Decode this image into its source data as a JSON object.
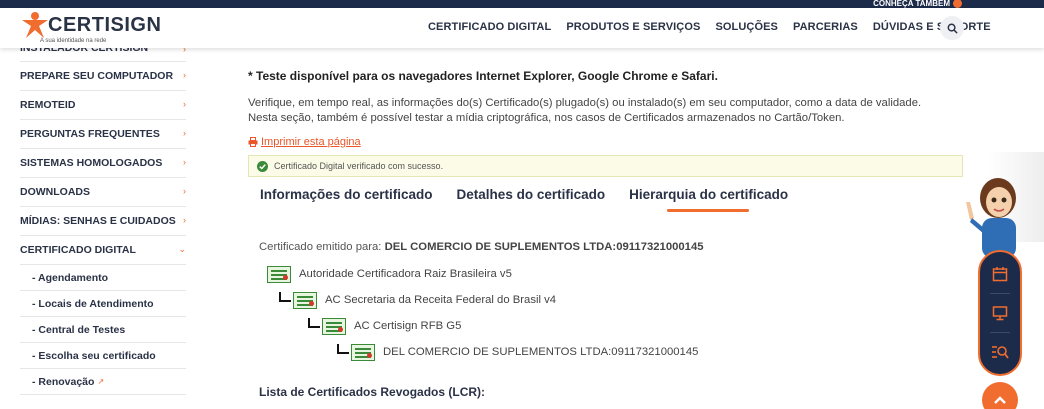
{
  "topbar": {
    "conheca_label": "CONHEÇA TAMBÉM"
  },
  "header": {
    "brand": "CERTISIGN",
    "tagline": "A sua identidade na rede",
    "nav": [
      "CERTIFICADO DIGITAL",
      "PRODUTOS E SERVIÇOS",
      "SOLUÇÕES",
      "PARCERIAS",
      "DÚVIDAS E SUPORTE"
    ]
  },
  "sidebar": {
    "items": [
      "INSTALADOR CERTISIGN",
      "PREPARE SEU COMPUTADOR",
      "REMOTEID",
      "PERGUNTAS FREQUENTES",
      "SISTEMAS HOMOLOGADOS",
      "DOWNLOADS",
      "MÍDIAS: SENHAS E CUIDADOS",
      "CERTIFICADO DIGITAL"
    ],
    "subitems": [
      "- Agendamento",
      "- Locais de Atendimento",
      "- Central de Testes",
      "- Escolha seu certificado",
      "- Renovação"
    ]
  },
  "main": {
    "note": "* Teste disponível para os navegadores Internet Explorer, Google Chrome e Safari.",
    "desc_line1": "Verifique, em tempo real, as informações do(s) Certificado(s) plugado(s) ou instalado(s) em seu computador, como a data de validade.",
    "desc_line2": "Nesta seção, também é possível testar a mídia criptográfica, nos casos de Certificados armazenados no Cartão/Token.",
    "print_label": "Imprimir esta página",
    "alert": "Certificado Digital verificado com sucesso.",
    "tabs": [
      "Informações do certificado",
      "Detalhes do certificado",
      "Hierarquia do certificado"
    ],
    "active_tab": "Hierarquia do certificado",
    "emitido_label": "Certificado emitido para:",
    "emitido_value": "DEL COMERCIO DE SUPLEMENTOS LTDA:09117321000145",
    "hierarchy": [
      "Autoridade Certificadora Raiz Brasileira v5",
      "AC Secretaria da Receita Federal do Brasil v4",
      "AC Certisign RFB G5",
      "DEL COMERCIO DE SUPLEMENTOS LTDA:09117321000145"
    ],
    "lcr_title": "Lista de Certificados Revogados (LCR):"
  },
  "colors": {
    "accent": "#f06c2f",
    "navy": "#1d2b4a",
    "link": "#e8562a"
  },
  "icons": [
    "search-icon",
    "chevron-right-icon",
    "chevron-down-icon",
    "external-link-icon",
    "printer-icon",
    "check-circle-icon",
    "certificate-icon",
    "calendar-icon",
    "monitor-icon",
    "search-list-icon",
    "arrow-up-icon"
  ]
}
